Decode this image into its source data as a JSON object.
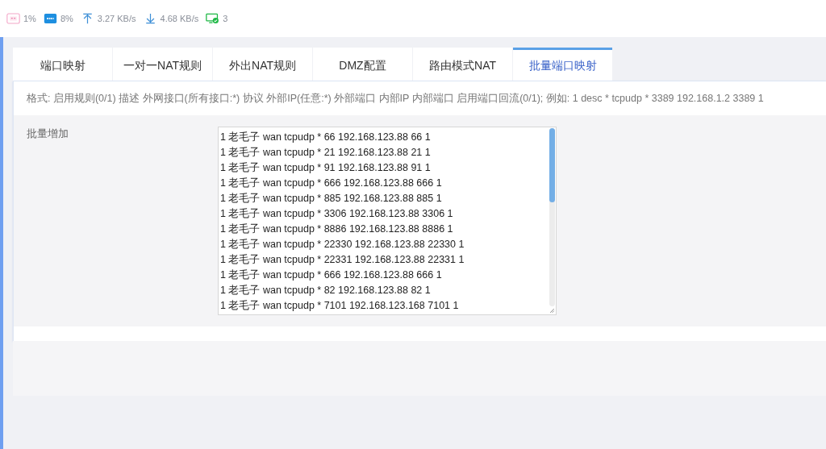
{
  "status_bar": [
    {
      "kind": "cpu",
      "text": "1%"
    },
    {
      "kind": "ram",
      "text": "8%"
    },
    {
      "kind": "upload",
      "text": "3.27 KB/s"
    },
    {
      "kind": "download",
      "text": "4.68 KB/s"
    },
    {
      "kind": "devices",
      "text": "3"
    }
  ],
  "tabs": [
    {
      "label": "端口映射",
      "selected": false
    },
    {
      "label": "一对一NAT规则",
      "selected": false
    },
    {
      "label": "外出NAT规则",
      "selected": false
    },
    {
      "label": "DMZ配置",
      "selected": false
    },
    {
      "label": "路由模式NAT",
      "selected": false
    },
    {
      "label": "批量端口映射",
      "selected": true
    }
  ],
  "format_hint": "格式: 启用规则(0/1) 描述 外网接口(所有接口:*) 协议 外部IP(任意:*) 外部端口 内部IP 内部端口 启用端口回流(0/1); 例如: 1 desc * tcpudp * 3389 192.168.1.2 3389 1",
  "form": {
    "label": "批量增加",
    "lines": [
      "1 老毛子 wan tcpudp * 66 192.168.123.88 66 1",
      "1 老毛子 wan tcpudp * 21 192.168.123.88 21 1",
      "1 老毛子 wan tcpudp * 91 192.168.123.88 91 1",
      "1 老毛子 wan tcpudp * 666 192.168.123.88 666 1",
      "1 老毛子 wan tcpudp * 885 192.168.123.88 885 1",
      "1 老毛子 wan tcpudp * 3306 192.168.123.88 3306 1",
      "1 老毛子 wan tcpudp * 8886 192.168.123.88 8886 1",
      "1 老毛子 wan tcpudp * 22330 192.168.123.88 22330 1",
      "1 老毛子 wan tcpudp * 22331 192.168.123.88 22331 1",
      "1 老毛子 wan tcpudp * 666 192.168.123.88 666 1",
      "1 老毛子 wan tcpudp * 82 192.168.123.88 82 1",
      "1 老毛子 wan tcpudp * 7101 192.168.123.168 7101 1"
    ]
  }
}
